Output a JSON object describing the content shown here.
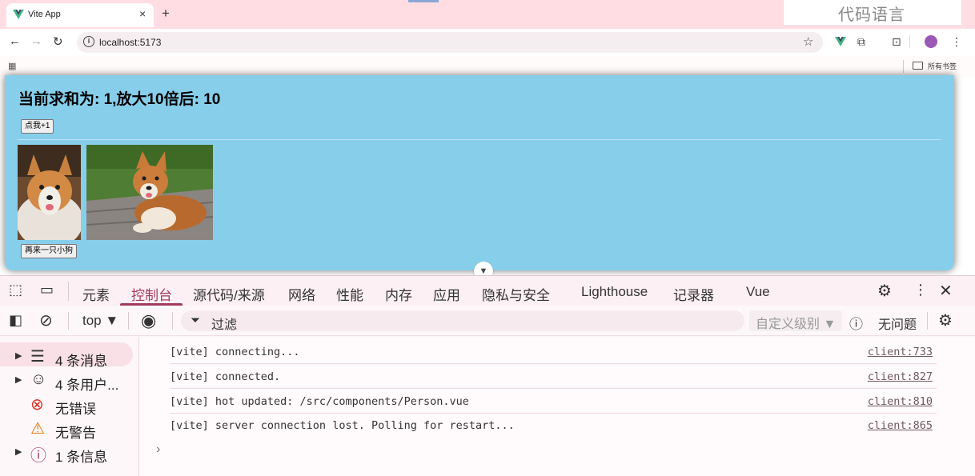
{
  "browser": {
    "tab_title": "Vite App",
    "tab_close": "×",
    "new_tab": "+",
    "url": "localhost:5173",
    "ime_text": "代码语言",
    "bookmarks_all": "所有书签",
    "accent_vue": "#41b883"
  },
  "page": {
    "sum_text": "当前求和为: 1,放大10倍后: 10",
    "add_button": "点我+1",
    "more_dog_button": "再来一只小狗",
    "background": "#87ceeb"
  },
  "devtools": {
    "tabs": [
      "元素",
      "控制台",
      "源代码/来源",
      "网络",
      "性能",
      "内存",
      "应用",
      "隐私与安全",
      "Lighthouse",
      "记录器",
      "Vue"
    ],
    "active_tab": "控制台",
    "context": "top ▼",
    "filter_placeholder": "过滤",
    "levels": "自定义级别 ▼",
    "issues": "无问题",
    "sidebar": [
      {
        "label": "4 条消息",
        "icon": "list-icon",
        "expandable": true
      },
      {
        "label": "4 条用户...",
        "icon": "user-icon",
        "expandable": true
      },
      {
        "label": "无错误",
        "icon": "error-icon",
        "expandable": false
      },
      {
        "label": "无警告",
        "icon": "warning-icon",
        "expandable": false
      },
      {
        "label": "1 条信息",
        "icon": "info-icon",
        "expandable": true
      }
    ],
    "logs": [
      {
        "message": "[vite] connecting...",
        "source": "client:733"
      },
      {
        "message": "[vite] connected.",
        "source": "client:827"
      },
      {
        "message": "[vite] hot updated: /src/components/Person.vue",
        "source": "client:810"
      },
      {
        "message": "[vite] server connection lost. Polling for restart...",
        "source": "client:865"
      }
    ],
    "prompt": "›"
  }
}
